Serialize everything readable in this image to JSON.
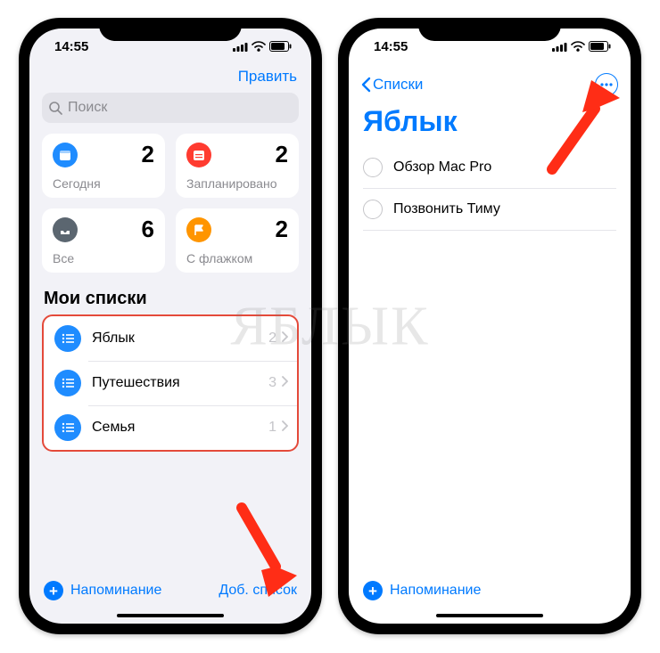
{
  "status": {
    "time": "14:55"
  },
  "left": {
    "edit": "Править",
    "search_placeholder": "Поиск",
    "cards": {
      "today": {
        "label": "Сегодня",
        "count": "2",
        "icon": "calendar-today-icon",
        "bg": "#1f8cff"
      },
      "scheduled": {
        "label": "Запланировано",
        "count": "2",
        "icon": "calendar-icon",
        "bg": "#ff3b30"
      },
      "all": {
        "label": "Все",
        "count": "6",
        "icon": "inbox-icon",
        "bg": "#5b6670"
      },
      "flagged": {
        "label": "С флажком",
        "count": "2",
        "icon": "flag-icon",
        "bg": "#ff9500"
      }
    },
    "my_lists_title": "Мои списки",
    "lists": [
      {
        "name": "Яблык",
        "count": "2",
        "color": "#1f8cff"
      },
      {
        "name": "Путешествия",
        "count": "3",
        "color": "#1f8cff"
      },
      {
        "name": "Семья",
        "count": "1",
        "color": "#1f8cff"
      }
    ],
    "new_reminder": "Напоминание",
    "add_list": "Доб. список"
  },
  "right": {
    "back": "Списки",
    "title": "Яблык",
    "items": [
      {
        "text": "Обзор Mac Pro"
      },
      {
        "text": "Позвонить Тиму"
      }
    ],
    "new_reminder": "Напоминание"
  },
  "watermark": "ЯБЛЫК",
  "colors": {
    "accent": "#007aff",
    "arrow": "#ff2d16"
  }
}
